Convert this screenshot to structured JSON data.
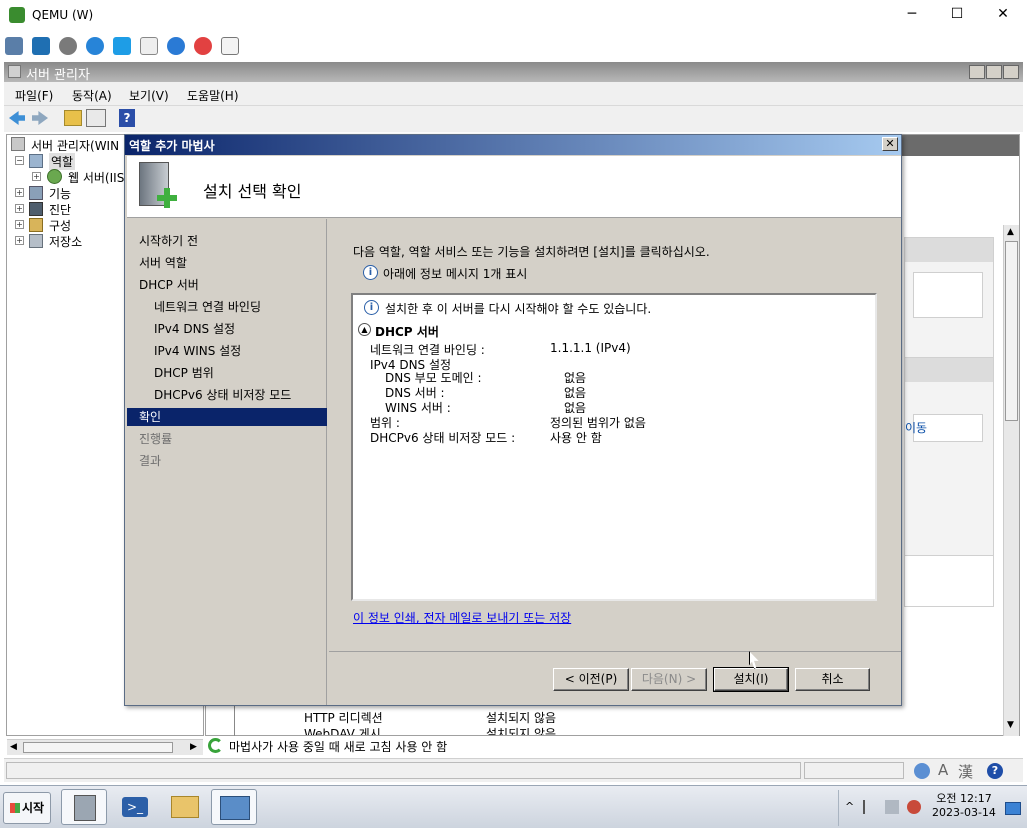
{
  "qemu": {
    "title": "QEMU (W)",
    "controls": [
      "─",
      "☐",
      "✕"
    ]
  },
  "server_manager": {
    "title": "서버 관리자",
    "menu": [
      "파일(F)",
      "동작(A)",
      "보기(V)",
      "도움말(H)"
    ],
    "tree": {
      "root": "서버 관리자(WIN",
      "items": [
        {
          "label": "역할"
        },
        {
          "label": "웹 서버(IIS"
        },
        {
          "label": "기능"
        },
        {
          "label": "진단"
        },
        {
          "label": "구성"
        },
        {
          "label": "저장소"
        }
      ]
    },
    "background_rows": [
      {
        "name": "HTTP 리디렉션",
        "status": "설치되지 않음"
      },
      {
        "name": "WebDAV 게시",
        "status": "설치되지 않음"
      }
    ],
    "right_link": "이동",
    "status": "마법사가 사용 중일 때 새로 고침 사용 안 함"
  },
  "wizard": {
    "title": "역할 추가 마법사",
    "header": "설치 선택 확인",
    "nav": [
      {
        "label": "시작하기 전",
        "sub": false,
        "state": "normal"
      },
      {
        "label": "서버 역할",
        "sub": false,
        "state": "normal"
      },
      {
        "label": "DHCP 서버",
        "sub": false,
        "state": "normal"
      },
      {
        "label": "네트워크 연결 바인딩",
        "sub": true,
        "state": "normal"
      },
      {
        "label": "IPv4 DNS 설정",
        "sub": true,
        "state": "normal"
      },
      {
        "label": "IPv4 WINS 설정",
        "sub": true,
        "state": "normal"
      },
      {
        "label": "DHCP 범위",
        "sub": true,
        "state": "normal"
      },
      {
        "label": "DHCPv6 상태 비저장 모드",
        "sub": true,
        "state": "normal"
      },
      {
        "label": "확인",
        "sub": false,
        "state": "selected"
      },
      {
        "label": "진행률",
        "sub": false,
        "state": "disabled"
      },
      {
        "label": "결과",
        "sub": false,
        "state": "disabled"
      }
    ],
    "intro": "다음 역할, 역할 서비스 또는 기능을 설치하려면 [설치]를 클릭하십시오.",
    "info_summary": "아래에 정보 메시지 1개 표시",
    "detail": {
      "restart_notice": "설치한 후 이 서버를 다시 시작해야 할 수도 있습니다.",
      "section": "DHCP 서버",
      "rows": [
        {
          "label": "네트워크 연결 바인딩 :",
          "value": "1.1.1.1 (IPv4)",
          "indent": 0
        },
        {
          "label": "IPv4 DNS 설정",
          "value": "",
          "indent": 0
        },
        {
          "label": "DNS 부모 도메인 :",
          "value": "없음",
          "indent": 1
        },
        {
          "label": "DNS 서버 :",
          "value": "없음",
          "indent": 1
        },
        {
          "label": "WINS 서버 :",
          "value": "없음",
          "indent": 1
        },
        {
          "label": "범위 :",
          "value": "정의된 범위가 없음",
          "indent": 0
        },
        {
          "label": "DHCPv6 상태 비저장 모드 :",
          "value": "사용 안 함",
          "indent": 0
        }
      ]
    },
    "print_link": "이 정보 인쇄, 전자 메일로 보내기 또는 저장",
    "buttons": {
      "prev": "< 이전(P)",
      "next": "다음(N) >",
      "install": "설치(I)",
      "cancel": "취소"
    }
  },
  "taskbar": {
    "start": "시작",
    "clock_time": "오전 12:17",
    "clock_date": "2023-03-14"
  }
}
